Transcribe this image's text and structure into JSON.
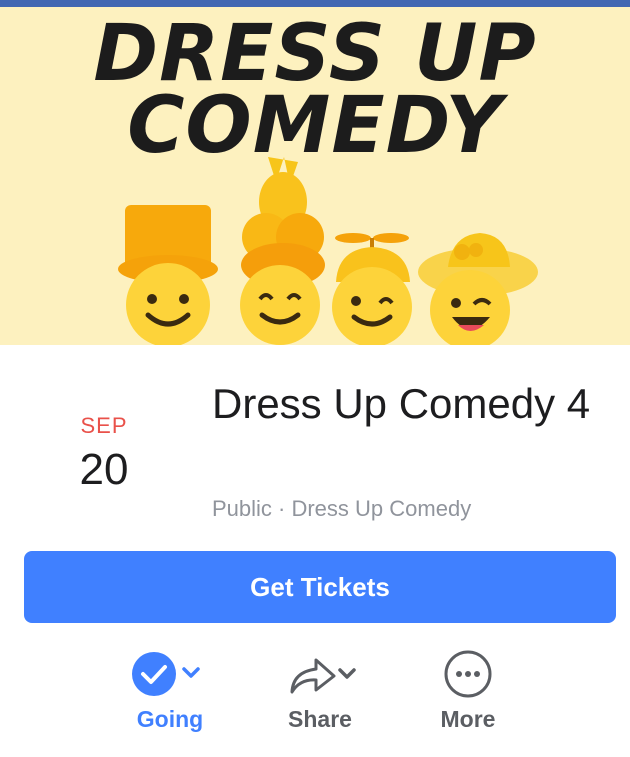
{
  "banner": {
    "line1": "DRESS UP",
    "line2": "COMEDY",
    "image": "four-emoji-faces-with-hats"
  },
  "event": {
    "month": "SEP",
    "day": "20",
    "title": "Dress Up Comedy 4",
    "meta": "Public · Dress Up Comedy"
  },
  "tickets_label": "Get Tickets",
  "actions": {
    "going": "Going",
    "share": "Share",
    "more": "More"
  },
  "colors": {
    "accent": "#4080ff",
    "top_bar": "#4267b2",
    "date_month": "#e9514a",
    "banner_bg": "#fdf1bf"
  },
  "icons": [
    "check-circle-icon",
    "chevron-down-icon",
    "share-arrow-icon",
    "more-dots-icon"
  ]
}
